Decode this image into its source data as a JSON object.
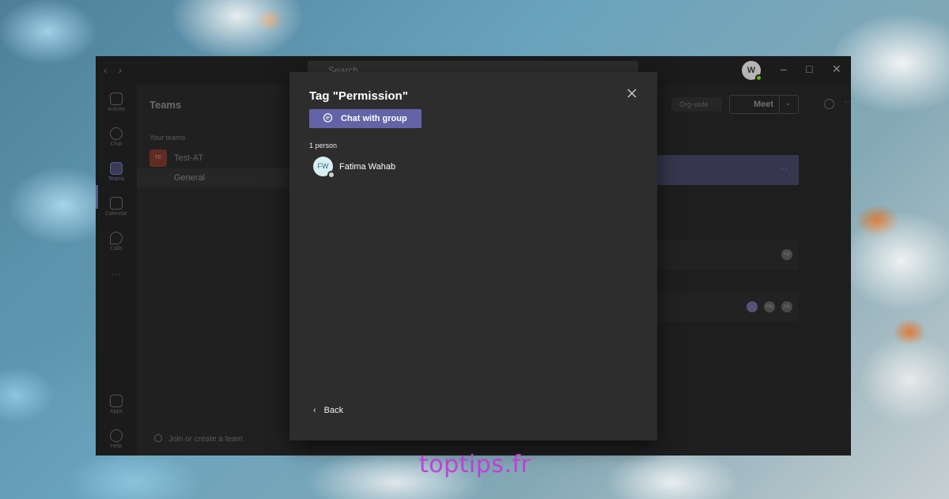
{
  "watermark": "toptips.fr",
  "titlebar": {
    "search_placeholder": "Search",
    "avatar_initial": "W"
  },
  "rail": {
    "items": [
      {
        "label": "Activity",
        "icon": "bell-icon"
      },
      {
        "label": "Chat",
        "icon": "chat-icon"
      },
      {
        "label": "Teams",
        "icon": "teams-icon",
        "active": true
      },
      {
        "label": "Calendar",
        "icon": "calendar-icon"
      },
      {
        "label": "Calls",
        "icon": "phone-icon"
      },
      {
        "label": "Apps",
        "icon": "apps-icon"
      },
      {
        "label": "Help",
        "icon": "help-icon"
      }
    ],
    "more": "···"
  },
  "teams_panel": {
    "heading": "Teams",
    "section_label": "Your teams",
    "team_initials": "TE",
    "team_name": "Test-AT",
    "channel_name": "General",
    "join_label": "Join or create a team"
  },
  "main": {
    "orgwide_label": "Org-wide",
    "meet_label": "Meet",
    "row1_avatar": "FW",
    "row2_avatars": [
      "",
      "FW",
      "FA"
    ],
    "more": "···"
  },
  "modal": {
    "title": "Tag \"Permission\"",
    "chat_button_label": "Chat with group",
    "count_label": "1 person",
    "person": {
      "initials": "FW",
      "name": "Fatima Wahab"
    },
    "back_label": "Back"
  },
  "colors": {
    "accent": "#6264a7",
    "modal_bg": "#2d2d2d",
    "window_bg": "#1f1f1f"
  }
}
